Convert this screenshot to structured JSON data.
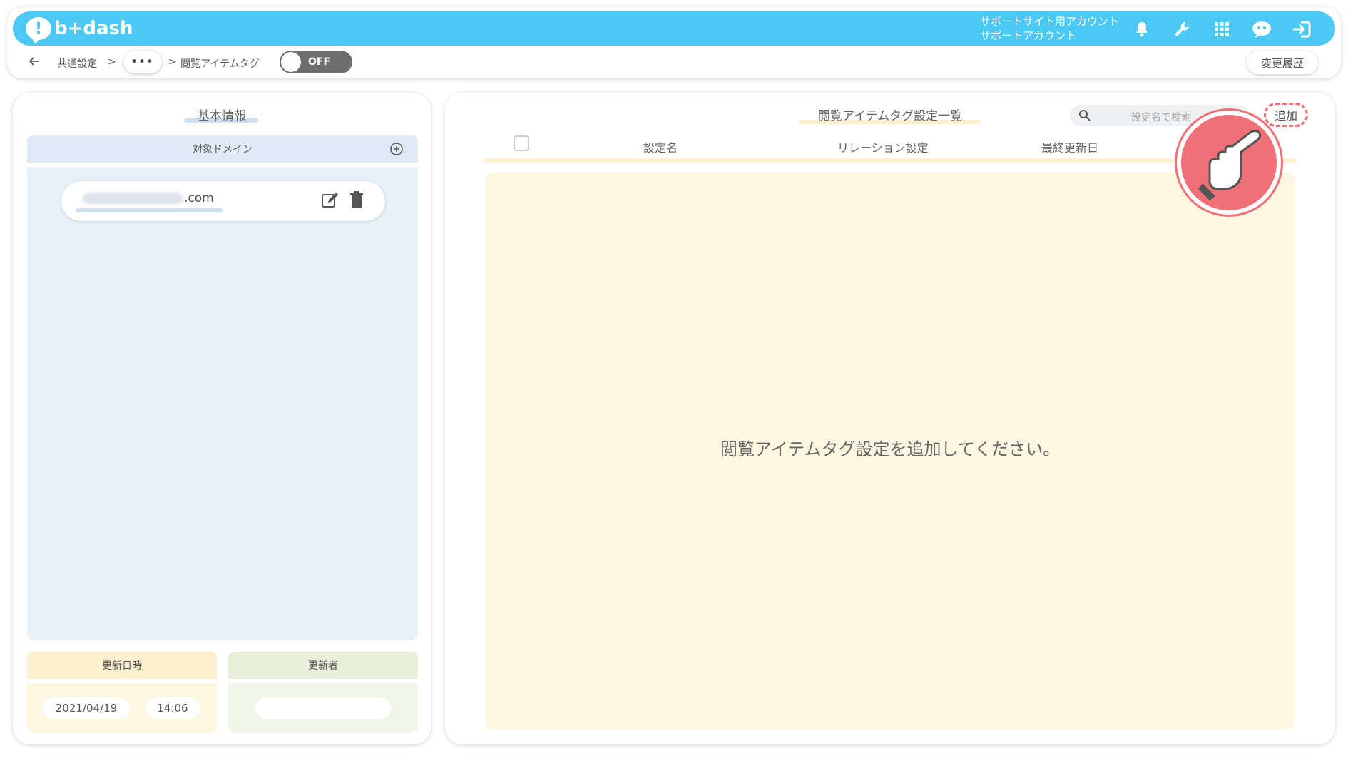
{
  "header": {
    "logo_text": "b+dash",
    "account_line1": "サポートサイト用アカウント",
    "account_line2": "サポートアカウント",
    "icons": [
      "bell-icon",
      "wrench-icon",
      "grid-icon",
      "chat-bot-icon",
      "logout-icon"
    ]
  },
  "breadcrumb": {
    "item1": "共通設定",
    "sep": ">",
    "ellipsis": "•••",
    "current": "閲覧アイテムタグ",
    "toggle_label": "OFF",
    "history_button": "変更履歴"
  },
  "left_panel": {
    "title": "基本情報",
    "domain_header": "対象ドメイン",
    "domain_suffix": ".com",
    "updated_at_label": "更新日時",
    "updated_by_label": "更新者",
    "updated_date": "2021/04/19",
    "updated_time": "14:06"
  },
  "right_panel": {
    "title": "閲覧アイテムタグ設定一覧",
    "search_placeholder": "設定名で検索",
    "add_button": "追加",
    "columns": [
      "設定名",
      "リレーション設定",
      "最終更新日"
    ],
    "empty_message": "閲覧アイテムタグ設定を追加してください。"
  },
  "colors": {
    "header_bg": "#4cc8f4",
    "domain_bg": "#e8f0f9",
    "list_bg": "#fdf7e1",
    "accent_red": "#ee6b73"
  }
}
